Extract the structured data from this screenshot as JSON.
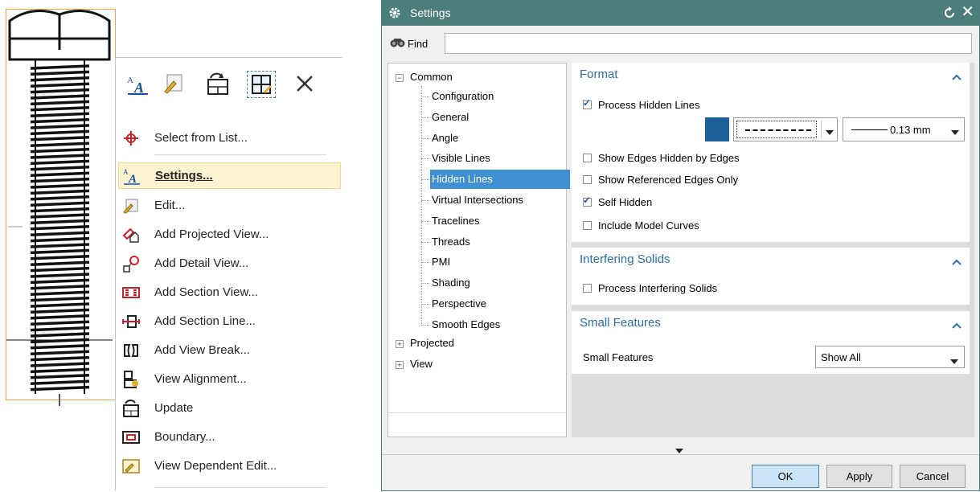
{
  "context_menu": {
    "toolbar_icons": [
      "settings-icon",
      "edit-icon",
      "update-icon",
      "boundary-icon",
      "close-icon"
    ],
    "items": [
      {
        "label": "Select from List...",
        "icon": "select-from-list-icon"
      },
      {
        "label": "Settings...",
        "icon": "settings-icon",
        "highlighted": true
      },
      {
        "label": "Edit...",
        "icon": "edit-icon"
      },
      {
        "label": "Add Projected View...",
        "icon": "projected-view-icon"
      },
      {
        "label": "Add Detail View...",
        "icon": "detail-view-icon"
      },
      {
        "label": "Add Section View...",
        "icon": "section-view-icon"
      },
      {
        "label": "Add Section Line...",
        "icon": "section-line-icon"
      },
      {
        "label": "Add View Break...",
        "icon": "view-break-icon"
      },
      {
        "label": "View Alignment...",
        "icon": "view-alignment-icon"
      },
      {
        "label": "Update",
        "icon": "update-icon"
      },
      {
        "label": "Boundary...",
        "icon": "boundary-icon"
      },
      {
        "label": "View Dependent Edit...",
        "icon": "view-dependent-edit-icon"
      }
    ]
  },
  "dialog": {
    "title": "Settings",
    "find_label": "Find",
    "find_value": "",
    "tree": {
      "common": "Common",
      "children": [
        "Configuration",
        "General",
        "Angle",
        "Visible Lines",
        "Hidden Lines",
        "Virtual Intersections",
        "Tracelines",
        "Threads",
        "PMI",
        "Shading",
        "Perspective",
        "Smooth Edges"
      ],
      "selected": "Hidden Lines",
      "projected": "Projected",
      "view": "View"
    },
    "format": {
      "header": "Format",
      "process_hidden_lines": {
        "label": "Process Hidden Lines",
        "checked": true
      },
      "line_color": "#1f5f9a",
      "line_type": "dashed",
      "line_width": "0.13 mm",
      "show_edges_hidden": {
        "label": "Show Edges Hidden by Edges",
        "checked": false
      },
      "show_referenced": {
        "label": "Show Referenced Edges Only",
        "checked": false
      },
      "self_hidden": {
        "label": "Self Hidden",
        "checked": true
      },
      "include_model_curves": {
        "label": "Include Model Curves",
        "checked": false
      }
    },
    "interfering": {
      "header": "Interfering Solids",
      "process_interfering": {
        "label": "Process Interfering Solids",
        "checked": false
      }
    },
    "small_features": {
      "header": "Small Features",
      "label": "Small Features",
      "value": "Show All"
    },
    "buttons": {
      "ok": "OK",
      "apply": "Apply",
      "cancel": "Cancel"
    }
  },
  "colors": {
    "titlebar": "#4d7d7a",
    "accent": "#2d6da3",
    "selection": "#3f8fd2"
  }
}
